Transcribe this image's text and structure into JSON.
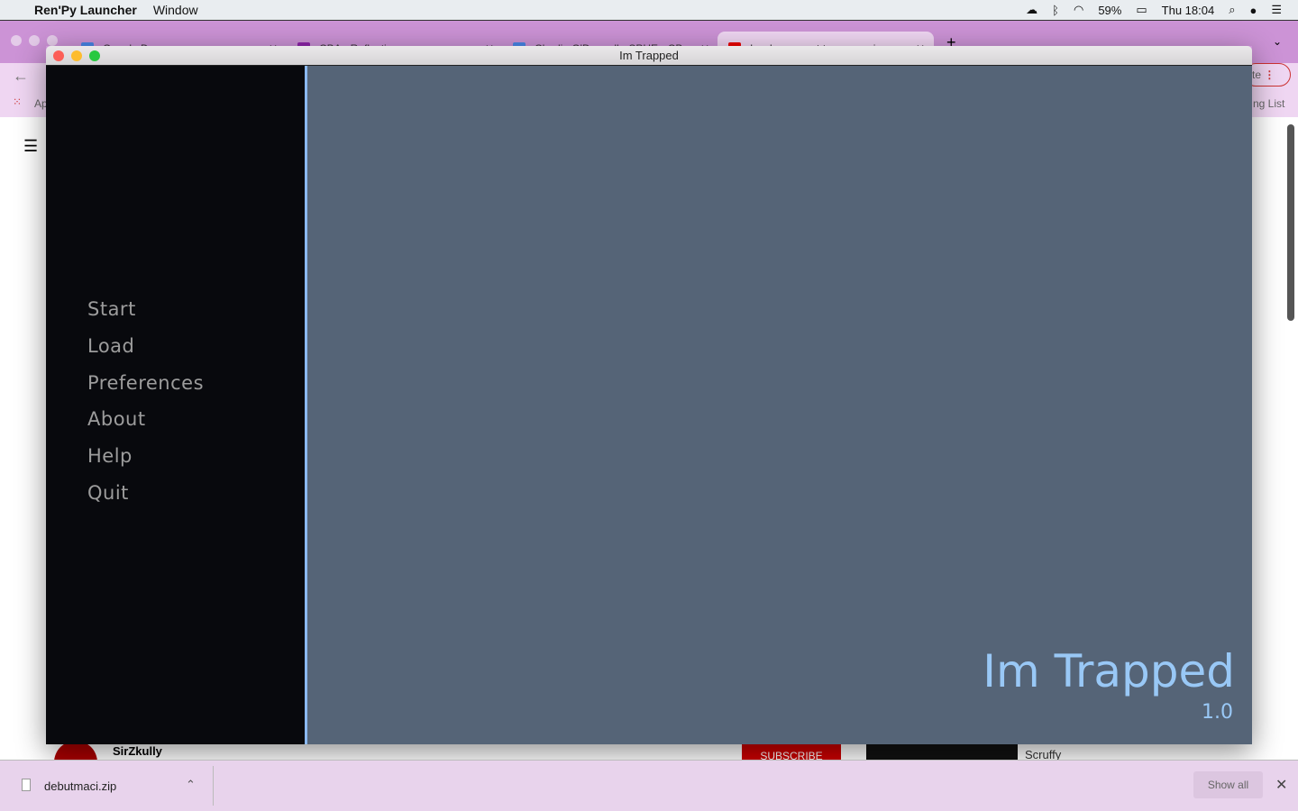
{
  "menubar": {
    "app": "Ren'Py Launcher",
    "menu": "Window",
    "battery": "59%",
    "clock": "Thu 18:04"
  },
  "browser": {
    "tabs": [
      {
        "title": "Google Docs",
        "color": "#4a86e8"
      },
      {
        "title": "CBA - Reflection",
        "color": "#8e24aa"
      },
      {
        "title": "Charlie O'Donnell - SPHE - CB",
        "color": "#4a86e8"
      },
      {
        "title": "I woke up next to you again",
        "color": "#e00"
      }
    ],
    "apps_label": "Ap",
    "reading_list": "ng List",
    "update": "te",
    "page": {
      "channel": "SirZkully",
      "subscribe": "SUBSCRIBE",
      "other_channel": "Scruffy"
    }
  },
  "window": {
    "title": "Im Trapped"
  },
  "game": {
    "menu": [
      "Start",
      "Load",
      "Preferences",
      "About",
      "Help",
      "Quit"
    ],
    "title": "Im Trapped",
    "version": "1.0",
    "colors": {
      "panel": "#08090d",
      "background": "#556477",
      "accent": "#99c8f6",
      "text": "#9c9c9c"
    }
  },
  "downloads": {
    "file": "debutmaci.zip",
    "show_all": "Show all"
  }
}
